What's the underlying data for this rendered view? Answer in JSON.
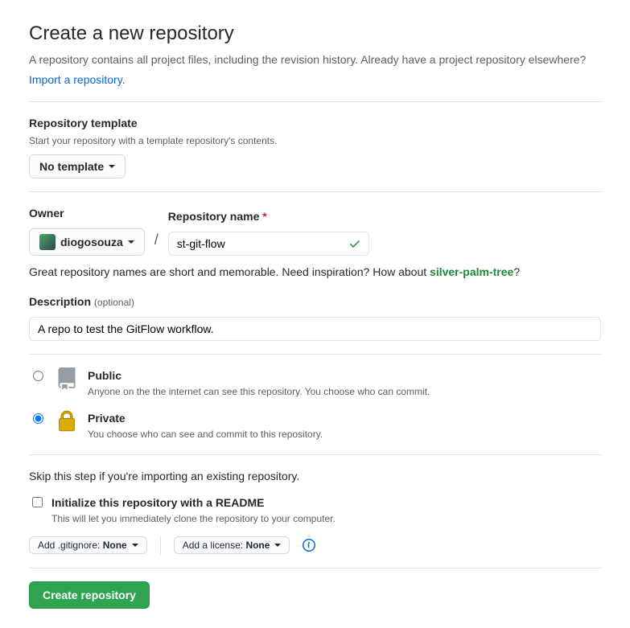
{
  "header": {
    "title": "Create a new repository",
    "description": "A repository contains all project files, including the revision history. Already have a project repository elsewhere?",
    "import_link": "Import a repository."
  },
  "template": {
    "label": "Repository template",
    "description": "Start your repository with a template repository's contents.",
    "value": "No template"
  },
  "owner": {
    "label": "Owner",
    "username": "diogosouza"
  },
  "repo": {
    "label": "Repository name",
    "value": "st-git-flow"
  },
  "hint": {
    "text": "Great repository names are short and memorable. Need inspiration? How about ",
    "suggestion": "silver-palm-tree",
    "qmark": "?"
  },
  "description": {
    "label": "Description",
    "optional": "(optional)",
    "value": "A repo to test the GitFlow workflow."
  },
  "visibility": {
    "public": {
      "title": "Public",
      "desc": "Anyone on the the internet can see this repository. You choose who can commit."
    },
    "private": {
      "title": "Private",
      "desc": "You choose who can see and commit to this repository."
    },
    "selected": "private"
  },
  "skip_note": "Skip this step if you're importing an existing repository.",
  "readme": {
    "label": "Initialize this repository with a README",
    "desc": "This will let you immediately clone the repository to your computer."
  },
  "gitignore": {
    "prefix": "Add .gitignore: ",
    "value": "None"
  },
  "license": {
    "prefix": "Add a license: ",
    "value": "None"
  },
  "submit": "Create repository"
}
